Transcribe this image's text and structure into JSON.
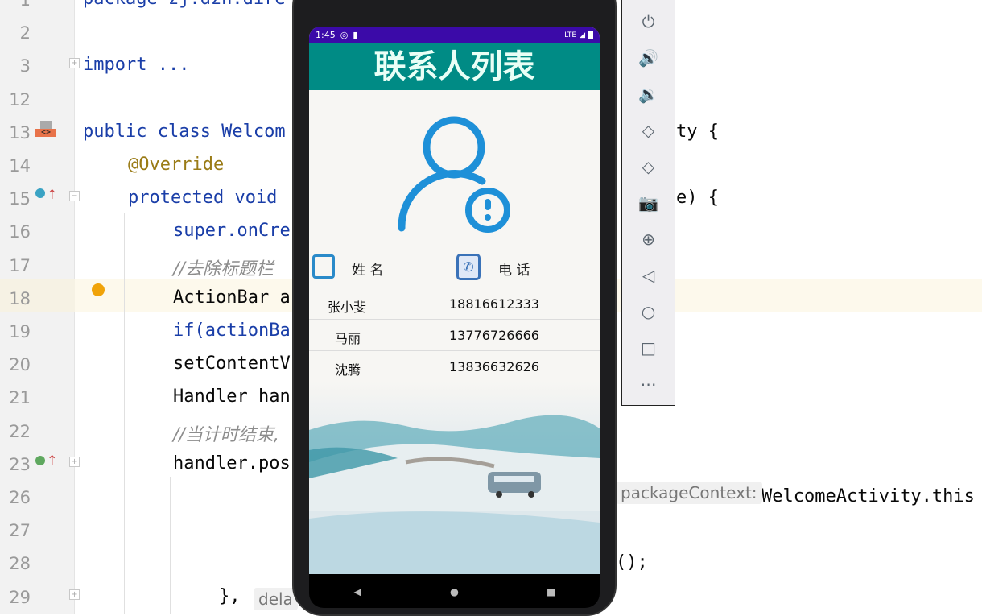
{
  "editor": {
    "lines": [
      {
        "n": "1",
        "code": "package zj.dzh.dire"
      },
      {
        "n": "2",
        "code": ""
      },
      {
        "n": "3",
        "code": "import ..."
      },
      {
        "n": "12",
        "code": ""
      },
      {
        "n": "13",
        "code": "public class Welcom",
        "right": "ty {"
      },
      {
        "n": "14",
        "code": "@Override"
      },
      {
        "n": "15",
        "code": "protected void",
        "right": "e) {"
      },
      {
        "n": "16",
        "code": "super.onCre"
      },
      {
        "n": "17",
        "code": "//去除标题栏"
      },
      {
        "n": "18",
        "code": "ActionBar a"
      },
      {
        "n": "19",
        "code": "if(actionBa"
      },
      {
        "n": "20",
        "code": "setContentV"
      },
      {
        "n": "21",
        "code": "Handler han"
      },
      {
        "n": "22",
        "code": "//当计时结束,"
      },
      {
        "n": "23",
        "code": "handler.pos"
      },
      {
        "n": "26",
        "code": "",
        "right": "WelcomeActivity.this"
      },
      {
        "n": "27",
        "code": ""
      },
      {
        "n": "28",
        "code": "",
        "right": "();"
      },
      {
        "n": "29",
        "code": "},",
        "hint": "dela"
      }
    ],
    "param_hint": "packageContext:"
  },
  "phone": {
    "status": {
      "time": "1:45",
      "network": "LTE"
    },
    "title": "联系人列表",
    "header": {
      "name": "姓 名",
      "phone": "电 话"
    },
    "contacts": [
      {
        "name": "张小斐",
        "phone": "18816612333"
      },
      {
        "name": "马丽",
        "phone": "13776726666"
      },
      {
        "name": "沈腾",
        "phone": "13836632626"
      }
    ],
    "colors": {
      "status": "#3b0aa8",
      "appbar": "#008b85",
      "icon": "#1e90d8"
    }
  },
  "emulator_toolbar": [
    "power-icon",
    "volume-up-icon",
    "volume-down-icon",
    "rotate-left-icon",
    "rotate-right-icon",
    "camera-icon",
    "zoom-icon",
    "back-icon",
    "home-icon",
    "overview-icon",
    "more-icon"
  ]
}
